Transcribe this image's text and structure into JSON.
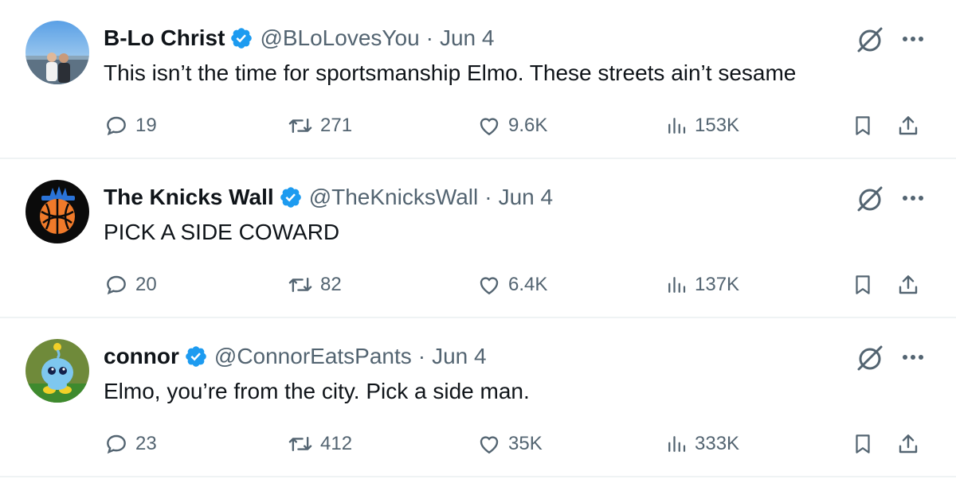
{
  "colors": {
    "verified": "#1d9bf0",
    "secondary_text": "#536471",
    "primary_text": "#0f1419",
    "divider": "#eff3f4"
  },
  "icons": {
    "verified": "verified-badge-icon",
    "grok": "grok-icon",
    "more": "more-icon",
    "reply": "reply-icon",
    "retweet": "retweet-icon",
    "like": "like-icon",
    "views": "views-icon",
    "bookmark": "bookmark-icon",
    "share": "share-icon"
  },
  "tweets": [
    {
      "name": "B-Lo Christ",
      "handle": "@BLoLovesYou",
      "separator": "·",
      "date": "Jun 4",
      "text": "This isn’t the time for sportsmanship Elmo. These streets ain’t sesame",
      "replies": "19",
      "retweets": "271",
      "likes": "9.6K",
      "views": "153K"
    },
    {
      "name": "The Knicks Wall",
      "handle": "@TheKnicksWall",
      "separator": "·",
      "date": "Jun 4",
      "text": "PICK A SIDE COWARD",
      "replies": "20",
      "retweets": "82",
      "likes": "6.4K",
      "views": "137K"
    },
    {
      "name": "connor",
      "handle": "@ConnorEatsPants",
      "separator": "·",
      "date": "Jun 4",
      "text": "Elmo, you’re from the city. Pick a side man.",
      "replies": "23",
      "retweets": "412",
      "likes": "35K",
      "views": "333K"
    }
  ]
}
